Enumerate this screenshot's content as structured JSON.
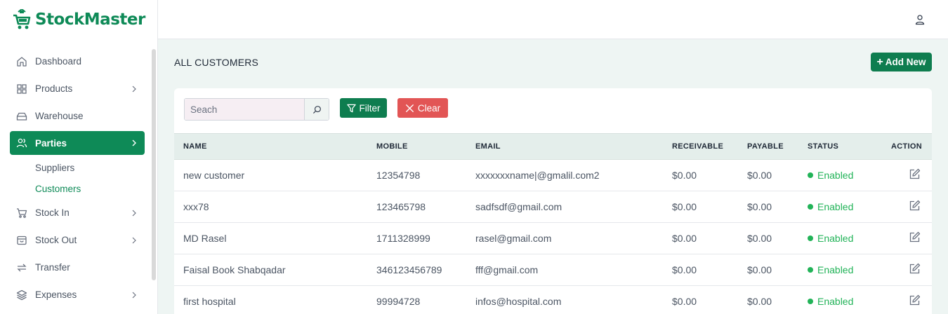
{
  "app": {
    "name": "StockMaster"
  },
  "sidebar": {
    "items": [
      {
        "label": "Dashboard",
        "icon": "home-icon",
        "has_children": false
      },
      {
        "label": "Products",
        "icon": "grid-icon",
        "has_children": true
      },
      {
        "label": "Warehouse",
        "icon": "warehouse-icon",
        "has_children": false
      },
      {
        "label": "Parties",
        "icon": "users-icon",
        "has_children": true,
        "active": true
      },
      {
        "label": "Stock In",
        "icon": "cart-icon",
        "has_children": true
      },
      {
        "label": "Stock Out",
        "icon": "box-icon",
        "has_children": true
      },
      {
        "label": "Transfer",
        "icon": "transfer-icon",
        "has_children": false
      },
      {
        "label": "Expenses",
        "icon": "layers-icon",
        "has_children": true
      }
    ],
    "sub_items": [
      {
        "label": "Suppliers"
      },
      {
        "label": "Customers",
        "active": true
      }
    ]
  },
  "header": {
    "user_icon": "user-icon"
  },
  "page": {
    "title": "ALL CUSTOMERS",
    "add_label": "Add New",
    "search_placeholder": "Seach",
    "filter_label": "Filter",
    "clear_label": "Clear"
  },
  "colors": {
    "primary": "#0e8a57",
    "danger": "#e25555",
    "success": "#22b358"
  },
  "table": {
    "columns": [
      "NAME",
      "MOBILE",
      "EMAIL",
      "RECEIVABLE",
      "PAYABLE",
      "STATUS",
      "ACTION"
    ],
    "rows": [
      {
        "name": "new customer",
        "mobile": "12354798",
        "email": "xxxxxxxname|@gmalil.com2",
        "receivable": "$0.00",
        "payable": "$0.00",
        "status": "Enabled"
      },
      {
        "name": "xxx78",
        "mobile": "123465798",
        "email": "sadfsdf@gmail.com",
        "receivable": "$0.00",
        "payable": "$0.00",
        "status": "Enabled"
      },
      {
        "name": "MD Rasel",
        "mobile": "1711328999",
        "email": "rasel@gmail.com",
        "receivable": "$0.00",
        "payable": "$0.00",
        "status": "Enabled"
      },
      {
        "name": "Faisal Book Shabqadar",
        "mobile": "346123456789",
        "email": "fff@gmail.com",
        "receivable": "$0.00",
        "payable": "$0.00",
        "status": "Enabled"
      },
      {
        "name": "first hospital",
        "mobile": "99994728",
        "email": "infos@hospital.com",
        "receivable": "$0.00",
        "payable": "$0.00",
        "status": "Enabled"
      }
    ]
  }
}
